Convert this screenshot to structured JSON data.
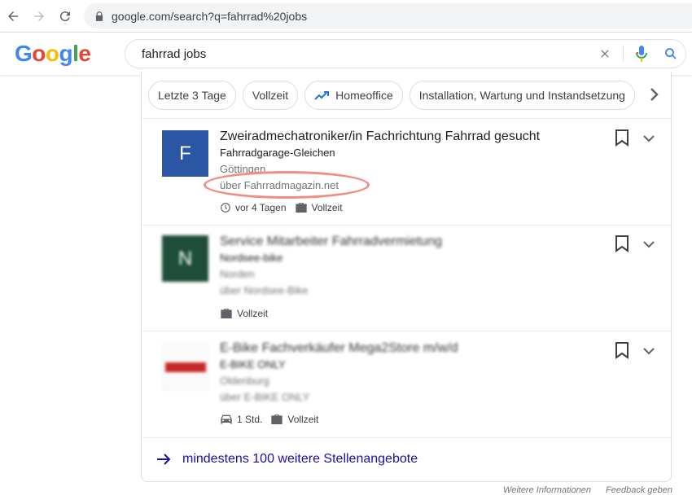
{
  "browser": {
    "url": "google.com/search?q=fahrrad%20jobs"
  },
  "search": {
    "logo": "Google",
    "query": "fahrrad jobs"
  },
  "chips": [
    {
      "label": "Letzte 3 Tage"
    },
    {
      "label": "Vollzeit"
    },
    {
      "label": "Homeoffice"
    },
    {
      "label": "Installation, Wartung und Instandsetzung"
    }
  ],
  "jobs": [
    {
      "logo_letter": "F",
      "logo_color": "#2a56a4",
      "title": "Zweiradmechatroniker/in Fachrichtung Fahrrad gesucht",
      "company": "Fahrradgarage-Gleichen",
      "location": "Göttingen",
      "via": "über Fahrradmagazin.net",
      "posted": "vor 4 Tagen",
      "type": "Vollzeit"
    },
    {
      "logo_letter": "N",
      "logo_color": "#1e4d3a",
      "title": "Service Mitarbeiter Fahrradvermietung",
      "company": "Nordsee-bike",
      "location": "Norden",
      "via": "über Nordsee-Bike",
      "type": "Vollzeit"
    },
    {
      "logo_letter": "",
      "logo_color": "#c62828",
      "title": "E-Bike Fachverkäufer Mega2Store m/w/d",
      "company": "E-BIKE ONLY",
      "location": "Oldenburg",
      "via": "über E-BIKE ONLY",
      "posted": "1 Std.",
      "type": "Vollzeit"
    }
  ],
  "more": {
    "label": "mindestens 100 weitere Stellenangebote"
  },
  "footer": {
    "info": "Weitere Informationen",
    "feedback": "Feedback geben"
  },
  "colors": {
    "link": "#1a0dab",
    "highlight": "#f28b82"
  }
}
